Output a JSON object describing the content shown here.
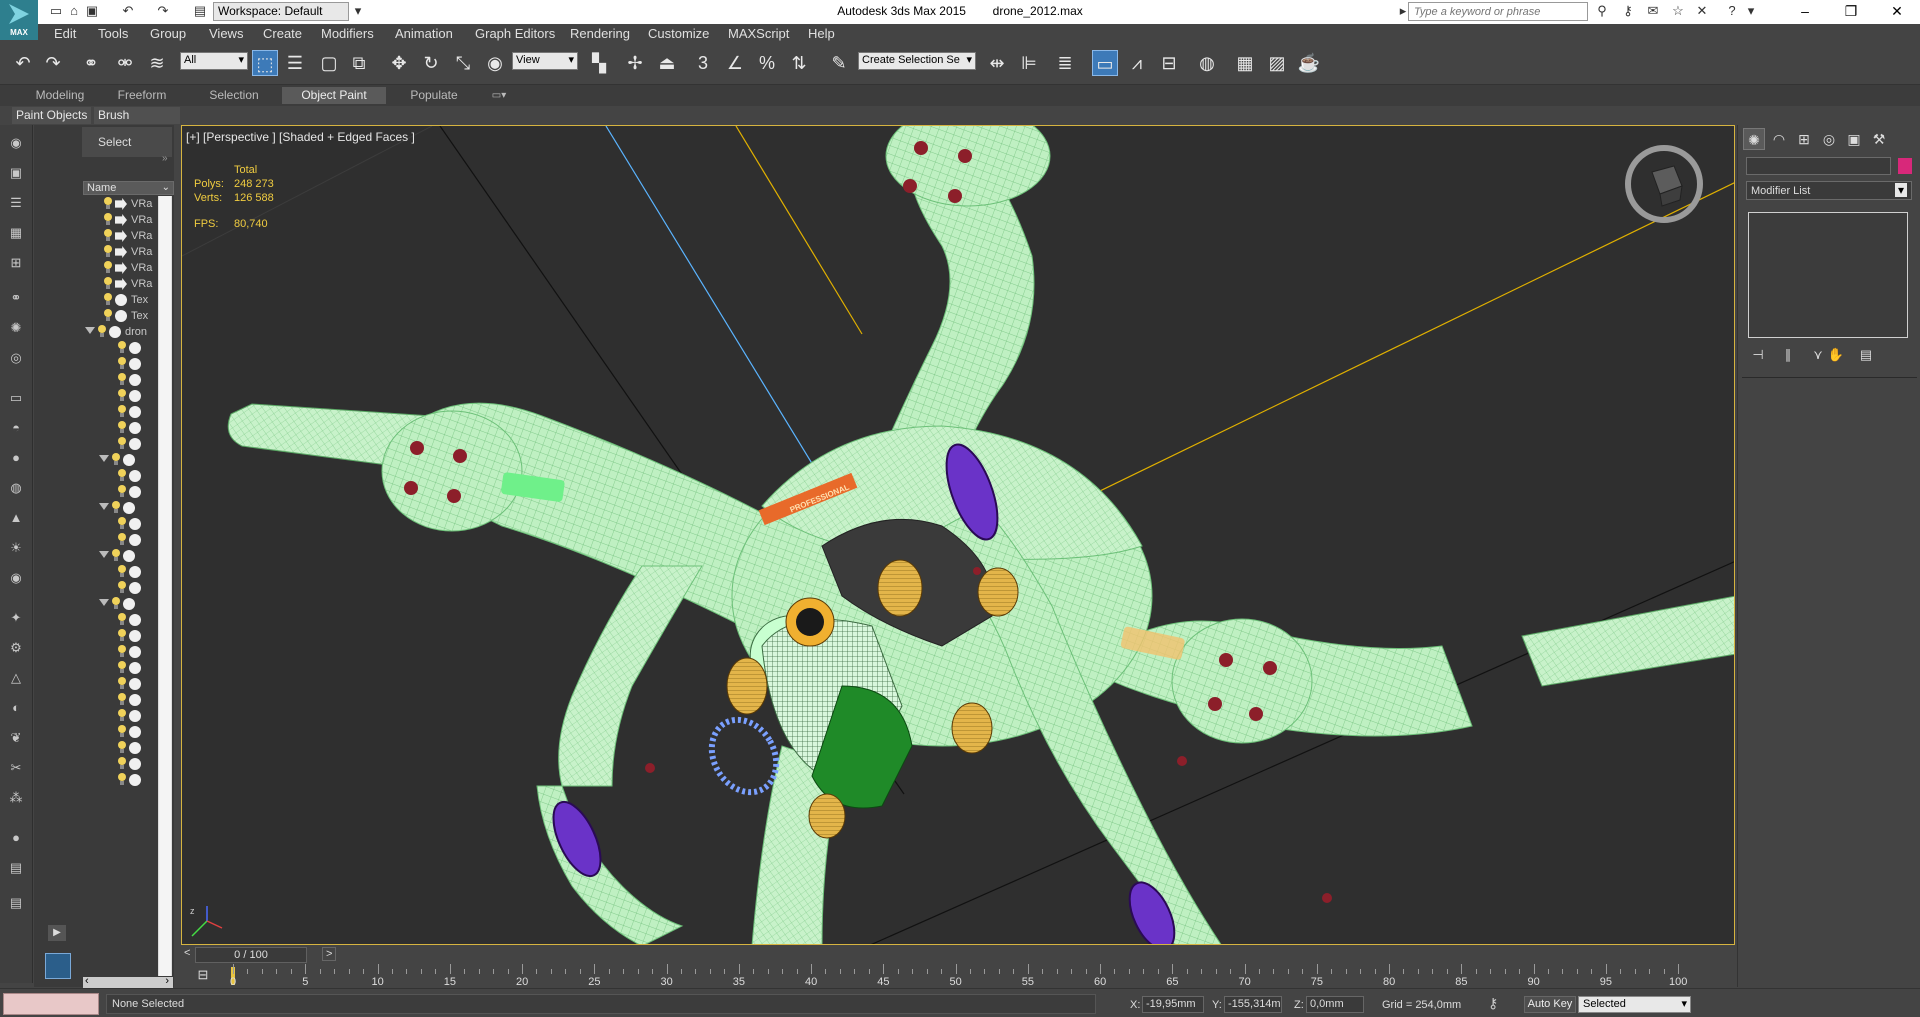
{
  "title_bar": {
    "logo_text": "MAX",
    "workspace": "Workspace: Default",
    "app_name": "Autodesk 3ds Max  2015",
    "file_name": "drone_2012.max",
    "search_placeholder": "Type a keyword or phrase"
  },
  "menu": {
    "items": [
      "Edit",
      "Tools",
      "Group",
      "Views",
      "Create",
      "Modifiers",
      "Animation",
      "Graph Editors",
      "Rendering",
      "Customize",
      "MAXScript",
      "Help"
    ]
  },
  "toolbar": {
    "selection_filter": "All",
    "reference_coord": "View",
    "named_selection": "Create Selection Se",
    "snap_label": "3"
  },
  "ribbon": {
    "tabs": [
      "Modeling",
      "Freeform",
      "Selection",
      "Object Paint",
      "Populate"
    ],
    "active_tab": "Object Paint",
    "subtabs": [
      "Paint Objects",
      "Brush Settings"
    ]
  },
  "scene_explorer": {
    "header": "Select",
    "column_name": "Name",
    "rows": [
      {
        "label": "VRa",
        "kind": "light"
      },
      {
        "label": "VRa",
        "kind": "light"
      },
      {
        "label": "VRa",
        "kind": "light"
      },
      {
        "label": "VRa",
        "kind": "light"
      },
      {
        "label": "VRa",
        "kind": "camera"
      },
      {
        "label": "VRa",
        "kind": "camera"
      },
      {
        "label": "Tex",
        "kind": "texture"
      },
      {
        "label": "Tex",
        "kind": "texture"
      },
      {
        "label": "dron",
        "kind": "group"
      }
    ]
  },
  "viewport": {
    "label": "[+] [Perspective ] [Shaded + Edged Faces ]",
    "stats": {
      "total_label": "Total",
      "polys_label": "Polys:",
      "polys_value": "248 273",
      "verts_label": "Verts:",
      "verts_value": "126 588",
      "fps_label": "FPS:",
      "fps_value": "80,740"
    },
    "logo_text": "PROFESSIONAL"
  },
  "timeline": {
    "slider_text": "0 / 100",
    "prev": "<",
    "next": ">",
    "labels": [
      "0",
      "5",
      "10",
      "15",
      "20",
      "25",
      "30",
      "35",
      "40",
      "45",
      "50",
      "55",
      "60",
      "65",
      "70",
      "75",
      "80",
      "85",
      "90",
      "95",
      "100"
    ]
  },
  "command_panel": {
    "modifier_list": "Modifier List",
    "object_color": "#d8287a"
  },
  "status_bar": {
    "status": "None Selected",
    "x_label": "X:",
    "x_value": "-19,95mm",
    "y_label": "Y:",
    "y_value": "-155,314m",
    "z_label": "Z:",
    "z_value": "0,0mm",
    "grid": "Grid = 254,0mm",
    "auto_key": "Auto Key",
    "key_filter": "Selected"
  },
  "colors": {
    "ui_bg": "#444444",
    "viewport_bg": "#2f2f2f",
    "wire_green": "#9fe8a4",
    "stats_yellow": "#f0cc40",
    "selection_blue": "#3d7ab8"
  }
}
